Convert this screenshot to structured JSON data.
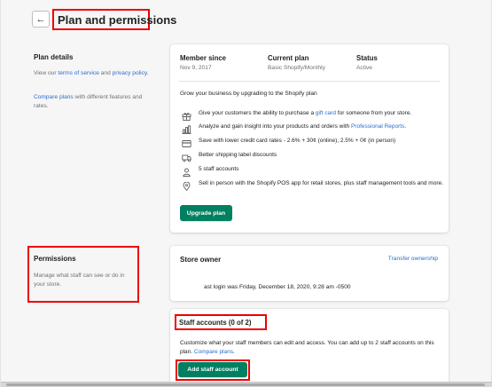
{
  "header": {
    "back_icon": "arrow-left-icon",
    "back_glyph": "←",
    "title": "Plan and permissions"
  },
  "plan_details": {
    "title": "Plan details",
    "desc_prefix": "View our ",
    "terms_link": "terms of service",
    "desc_mid": " and ",
    "privacy_link": "privacy policy",
    "desc_suffix": ".",
    "compare_link": "Compare plans",
    "compare_suffix": " with different features and rates."
  },
  "plan_card": {
    "member_since_label": "Member since",
    "member_since_value": "Nov 9, 2017",
    "current_plan_label": "Current plan",
    "current_plan_value": "Basic Shopify/Monthly",
    "status_label": "Status",
    "status_value": "Active",
    "grow_text": "Grow your business by upgrading to the Shopify plan",
    "features": [
      {
        "icon": "gift-icon",
        "pre": "Give your customers the ability to purchase a ",
        "link": "gift card",
        "post": " for someone from your store."
      },
      {
        "icon": "analytics-icon",
        "pre": "Analyze and gain insight into your products and orders with ",
        "link": "Professional Reports",
        "post": "."
      },
      {
        "icon": "credit-card-icon",
        "pre": "Save with lower credit card rates - 2.6% + 30¢ (online), 2.5% + 0¢ (in person)",
        "link": "",
        "post": ""
      },
      {
        "icon": "shipping-truck-icon",
        "pre": "Better shipping label discounts",
        "link": "",
        "post": ""
      },
      {
        "icon": "user-icon",
        "pre": "5 staff accounts",
        "link": "",
        "post": ""
      },
      {
        "icon": "location-pin-icon",
        "pre": "Sell in person with the Shopify POS app for retail stores, plus staff management tools and more.",
        "link": "",
        "post": ""
      }
    ],
    "upgrade_label": "Upgrade plan"
  },
  "permissions": {
    "title": "Permissions",
    "desc": "Manage what staff can see or do in your store."
  },
  "store_owner": {
    "title": "Store owner",
    "transfer_label": "Transfer ownership",
    "last_login": "ast login was Friday, December 18, 2020, 9:28 am -0500"
  },
  "staff": {
    "title": "Staff accounts (0 of 2)",
    "desc_prefix": "Customize what your staff members can edit and access. You can add up to 2 staff accounts on this plan. ",
    "compare_link": "Compare plans",
    "desc_suffix": ".",
    "add_label": "Add staff account"
  },
  "colors": {
    "accent_green": "#008060",
    "link_blue": "#2c6ecb",
    "highlight_red": "#ee0000"
  }
}
